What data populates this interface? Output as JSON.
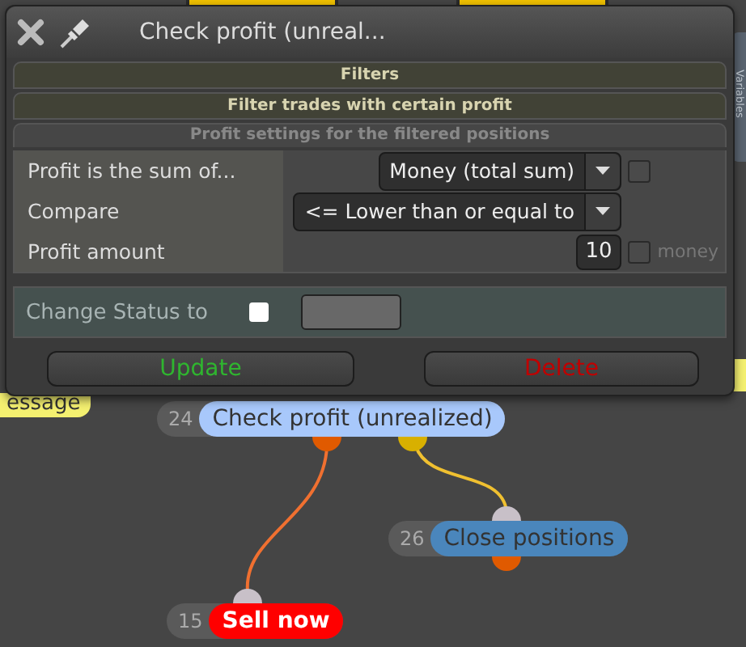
{
  "dialog": {
    "title": "Check profit (unreal...",
    "sections": [
      {
        "label": "Filters"
      },
      {
        "label": "Filter trades with certain profit"
      }
    ],
    "subheader": "Profit settings for the filtered positions",
    "rows": [
      {
        "label": "Profit is the sum of...",
        "kind": "select",
        "value": "Money (total sum)",
        "checkbox": {
          "checked": false
        }
      },
      {
        "label": "Compare",
        "kind": "select",
        "value": "<= Lower than or equal to"
      },
      {
        "label": "Profit amount",
        "kind": "number",
        "value": "10",
        "unit": "money",
        "checkbox": {
          "checked": false
        }
      }
    ],
    "status": {
      "label": "Change Status to",
      "checked": false
    },
    "buttons": [
      {
        "label": "Update",
        "kind": "confirm"
      },
      {
        "label": "Delete",
        "kind": "danger"
      }
    ]
  },
  "side_tab": {
    "label": "Variables"
  },
  "partial_node": {
    "label": "essage"
  },
  "nodes": [
    {
      "number": "24",
      "label": "Check profit (unrealized)",
      "color": "#a8c8fb"
    },
    {
      "number": "26",
      "label": "Close positions",
      "color": "#4a86bc"
    },
    {
      "number": "15",
      "label": "Sell now",
      "color": "#ff0000"
    }
  ]
}
